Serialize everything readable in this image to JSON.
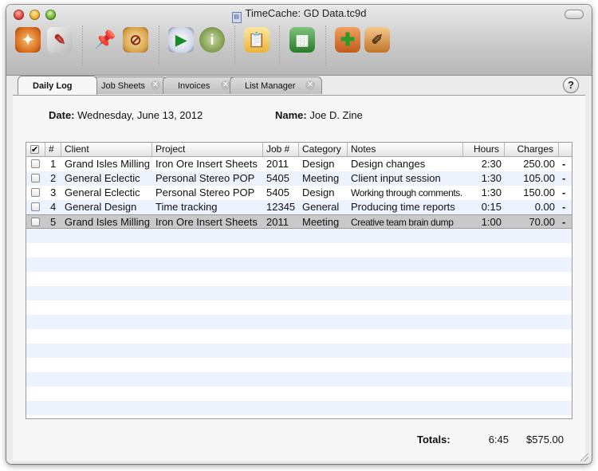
{
  "window": {
    "title": "TimeCache: GD Data.tc9d"
  },
  "toolbar": {
    "buttons": [
      {
        "name": "compass-icon"
      },
      {
        "name": "preferences-icon"
      },
      {
        "name": "pin-icon"
      },
      {
        "name": "stop-timer-icon"
      },
      {
        "name": "play-timer-icon"
      },
      {
        "name": "info-icon"
      },
      {
        "name": "clipboard-icon"
      },
      {
        "name": "spreadsheet-icon"
      },
      {
        "name": "add-entry-icon"
      },
      {
        "name": "edit-entry-icon"
      }
    ]
  },
  "tabs": [
    {
      "label": "Daily Log",
      "active": true
    },
    {
      "label": "Job Sheets"
    },
    {
      "label": "Invoices"
    },
    {
      "label": "List Manager"
    }
  ],
  "help_label": "?",
  "header": {
    "date_label": "Date:",
    "date_value": "Wednesday, June 13, 2012",
    "name_label": "Name:",
    "name_value": "Joe D. Zine"
  },
  "table": {
    "columns": [
      "#",
      "Client",
      "Project",
      "Job #",
      "Category",
      "Notes",
      "Hours",
      "Charges"
    ],
    "rows": [
      {
        "num": "1",
        "client": "Grand Isles Milling",
        "project": "Iron Ore Insert Sheets",
        "job": "2011",
        "category": "Design",
        "notes": "Design changes",
        "hours": "2:30",
        "charges": "250.00",
        "minus": "-"
      },
      {
        "num": "2",
        "client": "General Eclectic",
        "project": "Personal Stereo POP",
        "job": "5405",
        "category": "Meeting",
        "notes": "Client input session",
        "hours": "1:30",
        "charges": "105.00",
        "minus": "-"
      },
      {
        "num": "3",
        "client": "General Eclectic",
        "project": "Personal Stereo POP",
        "job": "5405",
        "category": "Design",
        "notes": "Working through comments...",
        "hours": "1:30",
        "charges": "150.00",
        "minus": "-"
      },
      {
        "num": "4",
        "client": "General Design",
        "project": "Time tracking",
        "job": "12345",
        "category": "General",
        "notes": "Producing time reports",
        "hours": "0:15",
        "charges": "0.00",
        "minus": "-"
      },
      {
        "num": "5",
        "client": "Grand Isles Milling",
        "project": "Iron Ore Insert Sheets",
        "job": "2011",
        "category": "Meeting",
        "notes": "Creative team brain dump",
        "hours": "1:00",
        "charges": "70.00",
        "minus": "-"
      }
    ]
  },
  "totals": {
    "label": "Totals:",
    "hours": "6:45",
    "charges": "$575.00"
  }
}
